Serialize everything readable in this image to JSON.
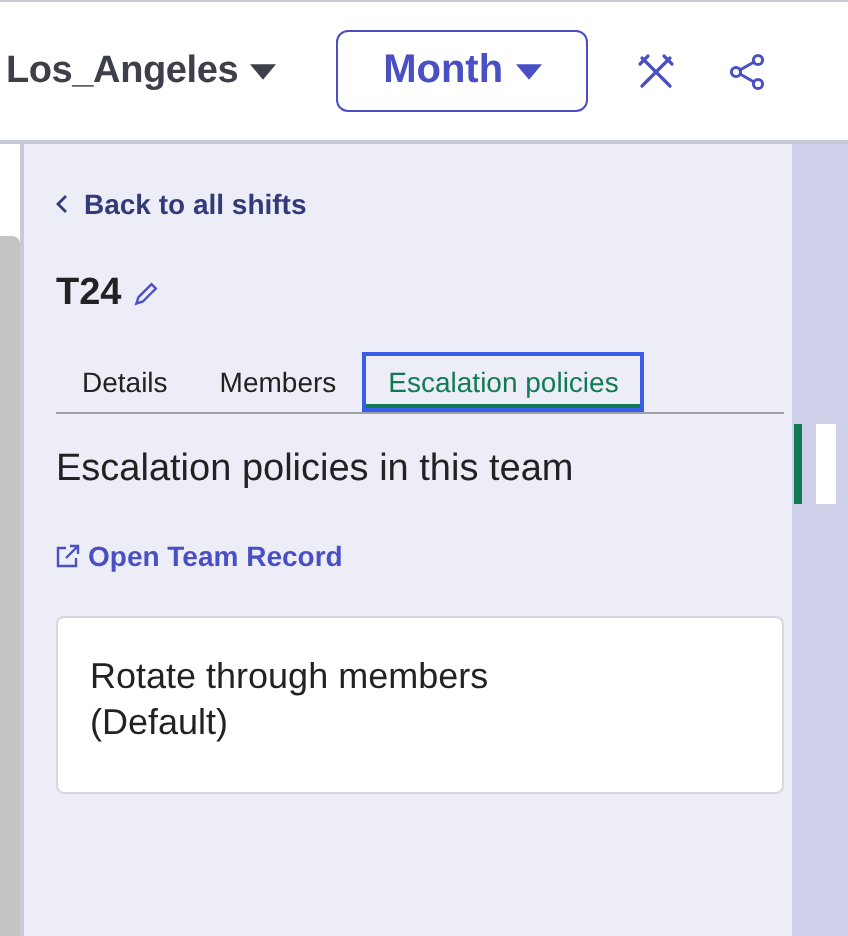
{
  "header": {
    "timezone": "Los_Angeles",
    "view": "Month"
  },
  "panel": {
    "back": "Back to all shifts",
    "title": "T24",
    "tabs": [
      {
        "label": "Details",
        "selected": false
      },
      {
        "label": "Members",
        "selected": false
      },
      {
        "label": "Escalation policies",
        "selected": true
      }
    ],
    "heading": "Escalation policies in this team",
    "link": "Open Team Record",
    "policies": [
      {
        "name": "Rotate through members (Default)"
      }
    ]
  }
}
